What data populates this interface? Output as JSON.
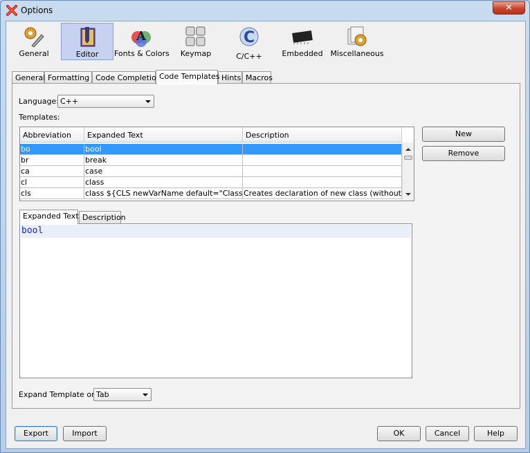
{
  "window": {
    "title": "Options",
    "close_glyph": "✕"
  },
  "categories": [
    {
      "label": "General",
      "icon": "wrench-gear-icon"
    },
    {
      "label": "Editor",
      "icon": "pen-notebook-icon",
      "selected": true
    },
    {
      "label": "Fonts & Colors",
      "icon": "font-palette-icon"
    },
    {
      "label": "Keymap",
      "icon": "keyboard-icon"
    },
    {
      "label": "C/C++",
      "icon": "c-language-icon"
    },
    {
      "label": "Embedded",
      "icon": "microchip-icon"
    },
    {
      "label": "Miscellaneous",
      "icon": "misc-gear-icon"
    }
  ],
  "tabs": [
    "General",
    "Formatting",
    "Code Completion",
    "Code Templates",
    "Hints",
    "Macros"
  ],
  "active_tab": "Code Templates",
  "language": {
    "label": "Language:",
    "value": "C++"
  },
  "templates_label": "Templates:",
  "table": {
    "columns": [
      "Abbreviation",
      "Expanded Text",
      "Description"
    ],
    "rows": [
      {
        "abbr": "bo",
        "expanded": "bool",
        "desc": ""
      },
      {
        "abbr": "br",
        "expanded": "break",
        "desc": ""
      },
      {
        "abbr": "ca",
        "expanded": "case",
        "desc": ""
      },
      {
        "abbr": "cl",
        "expanded": "class",
        "desc": ""
      },
      {
        "abbr": "cls",
        "expanded": "class ${CLS newVarName default=\"Class\"} {...",
        "desc": "Creates declaration of new class (without in..."
      }
    ]
  },
  "side_buttons": {
    "new": "New",
    "remove": "Remove"
  },
  "subtabs": [
    "Expanded Text",
    "Description"
  ],
  "editor_text": "bool",
  "expand_on": {
    "label": "Expand Template on:",
    "value": "Tab"
  },
  "bottom_buttons": {
    "export": "Export",
    "import": "Import",
    "ok": "OK",
    "cancel": "Cancel",
    "help": "Help"
  },
  "colors": {
    "selection": "#3399ff",
    "editor_text": "#2222cc",
    "category_selected": "#c6d2ef"
  }
}
